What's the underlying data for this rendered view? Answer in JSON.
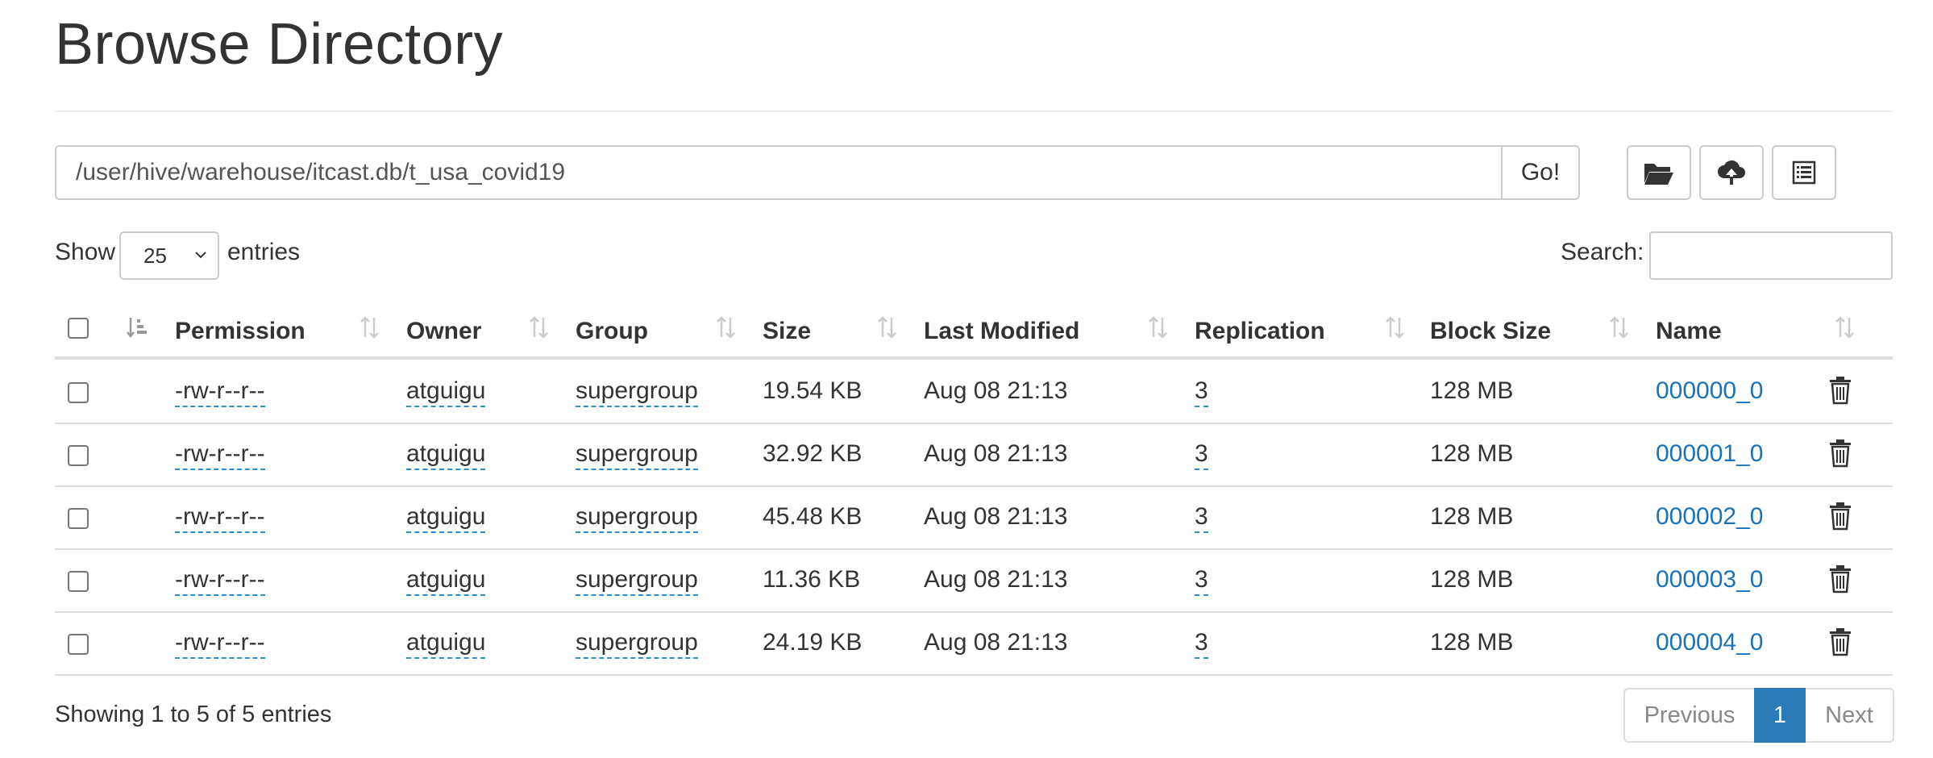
{
  "page": {
    "title": "Browse Directory"
  },
  "path_bar": {
    "value": "/user/hive/warehouse/itcast.db/t_usa_covid19",
    "go_label": "Go!"
  },
  "toolbar": {
    "icons": [
      "folder-open-icon",
      "cloud-upload-icon",
      "list-icon"
    ]
  },
  "length_menu": {
    "show_label": "Show",
    "selected": "25",
    "entries_label": "entries"
  },
  "search": {
    "label": "Search:",
    "value": ""
  },
  "table": {
    "headers": {
      "permission": "Permission",
      "owner": "Owner",
      "group": "Group",
      "size": "Size",
      "last_modified": "Last Modified",
      "replication": "Replication",
      "block_size": "Block Size",
      "name": "Name"
    },
    "rows": [
      {
        "permission": "-rw-r--r--",
        "owner": "atguigu",
        "group": "supergroup",
        "size": "19.54 KB",
        "last_modified": "Aug 08 21:13",
        "replication": "3",
        "block_size": "128 MB",
        "name": "000000_0"
      },
      {
        "permission": "-rw-r--r--",
        "owner": "atguigu",
        "group": "supergroup",
        "size": "32.92 KB",
        "last_modified": "Aug 08 21:13",
        "replication": "3",
        "block_size": "128 MB",
        "name": "000001_0"
      },
      {
        "permission": "-rw-r--r--",
        "owner": "atguigu",
        "group": "supergroup",
        "size": "45.48 KB",
        "last_modified": "Aug 08 21:13",
        "replication": "3",
        "block_size": "128 MB",
        "name": "000002_0"
      },
      {
        "permission": "-rw-r--r--",
        "owner": "atguigu",
        "group": "supergroup",
        "size": "11.36 KB",
        "last_modified": "Aug 08 21:13",
        "replication": "3",
        "block_size": "128 MB",
        "name": "000003_0"
      },
      {
        "permission": "-rw-r--r--",
        "owner": "atguigu",
        "group": "supergroup",
        "size": "24.19 KB",
        "last_modified": "Aug 08 21:13",
        "replication": "3",
        "block_size": "128 MB",
        "name": "000004_0"
      }
    ]
  },
  "footer": {
    "info": "Showing 1 to 5 of 5 entries",
    "previous": "Previous",
    "current_page": "1",
    "next": "Next"
  },
  "colors": {
    "link": "#1a73b8",
    "active_page": "#2a7ab8",
    "dotted_underline": "#2a8fd1"
  }
}
